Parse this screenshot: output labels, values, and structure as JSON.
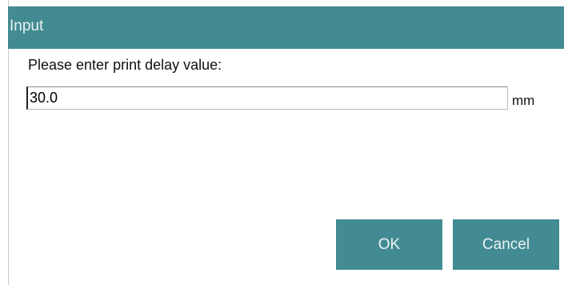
{
  "dialog": {
    "title": "Input",
    "prompt": "Please enter print delay value:",
    "input_value": "30.0",
    "unit": "mm",
    "ok_label": "OK",
    "cancel_label": "Cancel"
  },
  "colors": {
    "accent": "#438b93",
    "accent_text": "#e9f3f3"
  }
}
